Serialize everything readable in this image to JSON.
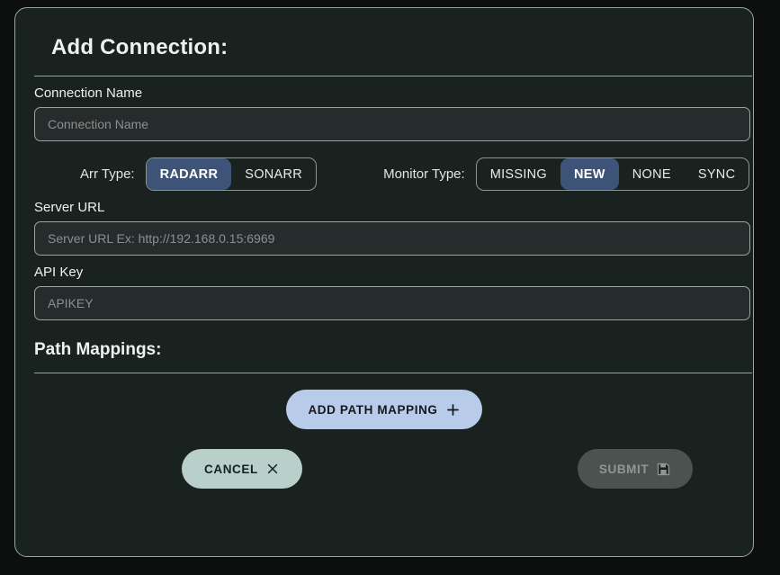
{
  "dialog": {
    "title": "Add Connection:"
  },
  "fields": {
    "connection_name": {
      "label": "Connection Name",
      "placeholder": "Connection Name",
      "value": ""
    },
    "server_url": {
      "label": "Server URL",
      "placeholder": "Server URL Ex: http://192.168.0.15:6969",
      "value": ""
    },
    "api_key": {
      "label": "API Key",
      "placeholder": "APIKEY",
      "value": ""
    }
  },
  "arr_type": {
    "caption": "Arr Type:",
    "selected": "RADARR",
    "options": [
      {
        "label": "RADARR",
        "selected": true
      },
      {
        "label": "SONARR",
        "selected": false
      }
    ]
  },
  "monitor_type": {
    "caption": "Monitor Type:",
    "selected": "NEW",
    "options": [
      {
        "label": "MISSING",
        "selected": false
      },
      {
        "label": "NEW",
        "selected": true
      },
      {
        "label": "NONE",
        "selected": false
      },
      {
        "label": "SYNC",
        "selected": false
      }
    ]
  },
  "path_mappings": {
    "title": "Path Mappings:",
    "add_button": {
      "label": "ADD PATH MAPPING",
      "icon": "plus-icon"
    }
  },
  "footer": {
    "cancel": {
      "label": "CANCEL",
      "icon": "close-x-icon"
    },
    "submit": {
      "label": "SUBMIT",
      "icon": "save-floppy-icon",
      "disabled": true
    }
  },
  "colors": {
    "page_background": "#0d0f0f",
    "card_background": "#1a2220",
    "card_border": "#9aa5a3",
    "input_background": "#262c2c",
    "segment_selected": "#3d5478",
    "add_button": "#b8cbe8",
    "cancel_button": "#b9d0ca",
    "submit_disabled": "#4b5350",
    "text_primary": "#eef1ef",
    "text_placeholder": "#8e8e8e"
  }
}
